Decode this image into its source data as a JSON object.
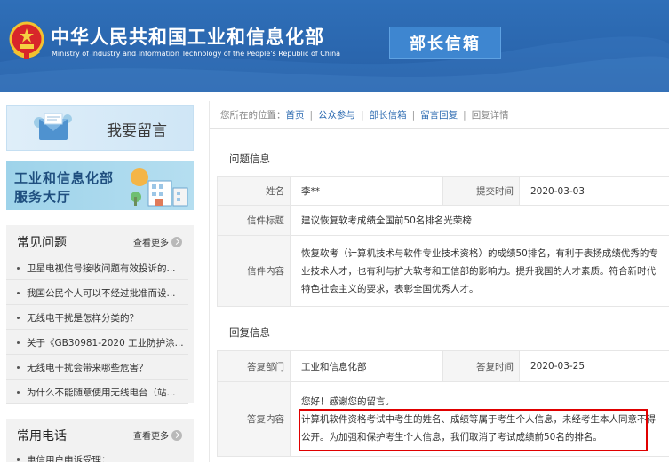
{
  "header": {
    "title": "中华人民共和国工业和信息化部",
    "subtitle": "Ministry of Industry and Information Technology of the People's Republic of China",
    "tab_label": "部长信箱",
    "emblem_icon": "national-emblem-icon",
    "bg_color": "#2c68b0"
  },
  "sidebar": {
    "leave_message_label": "我要留言",
    "hall_line1": "工业和信息化部",
    "hall_line2": "服务大厅",
    "faq": {
      "title": "常见问题",
      "more": "查看更多",
      "items": [
        "卫星电视信号接收问题有效投诉的...",
        "我国公民个人可以不经过批准而设...",
        "无线电干扰是怎样分类的？",
        "关于《GB30981-2020 工业防护涂...",
        "无线电干扰会带来哪些危害？",
        "为什么不能随意使用无线电台（站..."
      ]
    },
    "phone": {
      "title": "常用电话",
      "more": "查看更多",
      "first_item": "电信用户申诉受理："
    }
  },
  "breadcrumb": {
    "prefix": "您所在的位置：",
    "items": [
      "首页",
      "公众参与",
      "部长信箱",
      "留言回复"
    ],
    "current": "回复详情"
  },
  "question": {
    "section_title": "问题信息",
    "name_label": "姓名",
    "name_value": "李**",
    "submit_time_label": "提交时间",
    "submit_time_value": "2020-03-03",
    "subject_label": "信件标题",
    "subject_value": "建议恢复软考成绩全国前50名排名光荣榜",
    "content_label": "信件内容",
    "content_value": "恢复软考（计算机技术与软件专业技术资格）的成绩50排名，有利于表扬成绩优秀的专业技术人才，也有利与扩大软考和工信部的影响力。提升我国的人才素质。符合新时代特色社会主义的要求，表彰全国优秀人才。"
  },
  "reply": {
    "section_title": "回复信息",
    "dept_label": "答复部门",
    "dept_value": "工业和信息化部",
    "time_label": "答复时间",
    "time_value": "2020-03-25",
    "content_label": "答复内容",
    "greeting": "您好！感谢您的留言。",
    "body": "计算机软件资格考试中考生的姓名、成绩等属于考生个人信息，未经考生本人同意不得公开。为加强和保护考生个人信息，我们取消了考试成绩前50名的排名。",
    "highlight_color": "#e00000"
  }
}
